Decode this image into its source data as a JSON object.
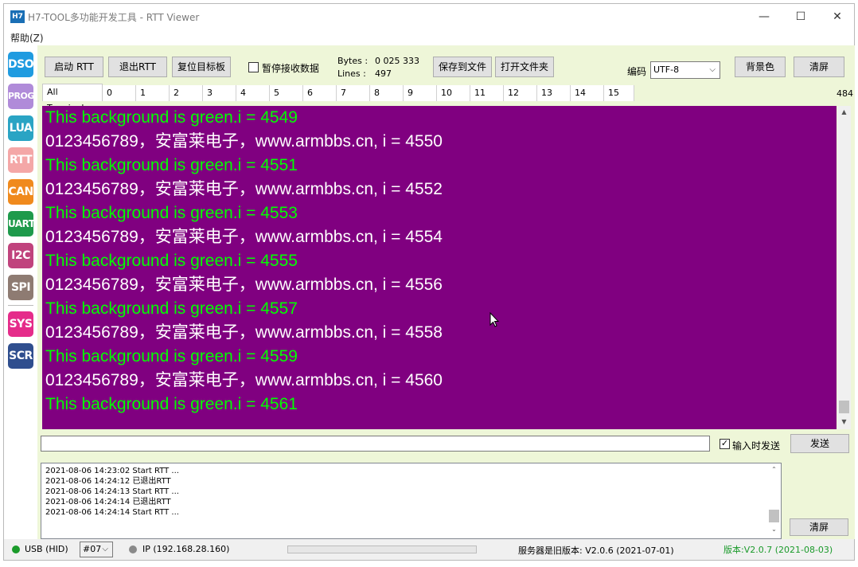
{
  "window": {
    "icon_text": "H7",
    "title": "H7-TOOL多功能开发工具 - RTT Viewer",
    "minimize_glyph": "—",
    "maximize_glyph": "☐",
    "close_glyph": "✕"
  },
  "menu": {
    "help": "帮助(Z)"
  },
  "rail": {
    "items": [
      {
        "label": "DSO",
        "color": "#1f9be0"
      },
      {
        "label": "PROG",
        "color": "#b08bd9"
      },
      {
        "label": "LUA",
        "color": "#2aa4c4"
      },
      {
        "label": "RTT",
        "color": "#f4a7a7"
      },
      {
        "label": "CAN",
        "color": "#f08a1d"
      },
      {
        "label": "UART",
        "color": "#1e9a4b"
      },
      {
        "label": "I2C",
        "color": "#c0437d"
      },
      {
        "label": "SPI",
        "color": "#8e7b72"
      },
      {
        "label": "SYS",
        "color": "#e52c8a"
      },
      {
        "label": "SCR",
        "color": "#2f4e8e"
      }
    ]
  },
  "toolbar": {
    "start_rtt": "启动 RTT",
    "exit_rtt": "退出RTT",
    "reset_target": "复位目标板",
    "pause_label": "暂停接收数据",
    "pause_checked": false,
    "bytes_label": "Bytes :",
    "bytes_value": "0 025 333",
    "lines_label": "Lines :",
    "lines_value": "497",
    "save_file": "保存到文件",
    "open_folder": "打开文件夹",
    "encoding_label": "编码",
    "encoding_value": "UTF-8",
    "bg_color": "背景色",
    "clear": "清屏"
  },
  "tabs": {
    "items": [
      "All Terminals",
      "0",
      "1",
      "2",
      "3",
      "4",
      "5",
      "6",
      "7",
      "8",
      "9",
      "10",
      "11",
      "12",
      "13",
      "14",
      "15"
    ],
    "active": "All Terminals",
    "count": "484"
  },
  "terminal": {
    "background": "#800080",
    "lines": [
      {
        "text": "This background is green.i = 4549",
        "color": "green"
      },
      {
        "text": "0123456789，安富莱电子，www.armbbs.cn, i = 4550",
        "color": "white"
      },
      {
        "text": "This background is green.i = 4551",
        "color": "green"
      },
      {
        "text": "0123456789，安富莱电子，www.armbbs.cn, i = 4552",
        "color": "white"
      },
      {
        "text": "This background is green.i = 4553",
        "color": "green"
      },
      {
        "text": "0123456789，安富莱电子，www.armbbs.cn, i = 4554",
        "color": "white"
      },
      {
        "text": "This background is green.i = 4555",
        "color": "green"
      },
      {
        "text": "0123456789，安富莱电子，www.armbbs.cn, i = 4556",
        "color": "white"
      },
      {
        "text": "This background is green.i = 4557",
        "color": "green"
      },
      {
        "text": "0123456789，安富莱电子，www.armbbs.cn, i = 4558",
        "color": "white"
      },
      {
        "text": "This background is green.i = 4559",
        "color": "green"
      },
      {
        "text": "0123456789，安富莱电子，www.armbbs.cn, i = 4560",
        "color": "white"
      },
      {
        "text": "This background is green.i = 4561",
        "color": "green"
      }
    ]
  },
  "send": {
    "input_value": "",
    "send_on_input_label": "输入时发送",
    "send_on_input_checked": true,
    "send_button": "发送"
  },
  "log": {
    "lines": [
      "2021-08-06 14:23:02 Start RTT ...",
      "2021-08-06 14:24:12 已退出RTT",
      "2021-08-06 14:24:13 Start RTT ...",
      "2021-08-06 14:24:14 已退出RTT",
      "2021-08-06 14:24:14 Start RTT ..."
    ],
    "clear": "清屏"
  },
  "status": {
    "usb_label": "USB (HID)",
    "usb_color": "#1a9a2a",
    "device_select": "#07",
    "ip_label": "IP (192.168.28.160)",
    "ip_color": "#8a8a8a",
    "server_version": "服务器是旧版本: V2.0.6 (2021-07-01)",
    "local_version": "版本:V2.0.7 (2021-08-03)",
    "local_version_color": "#1a9a2a"
  }
}
